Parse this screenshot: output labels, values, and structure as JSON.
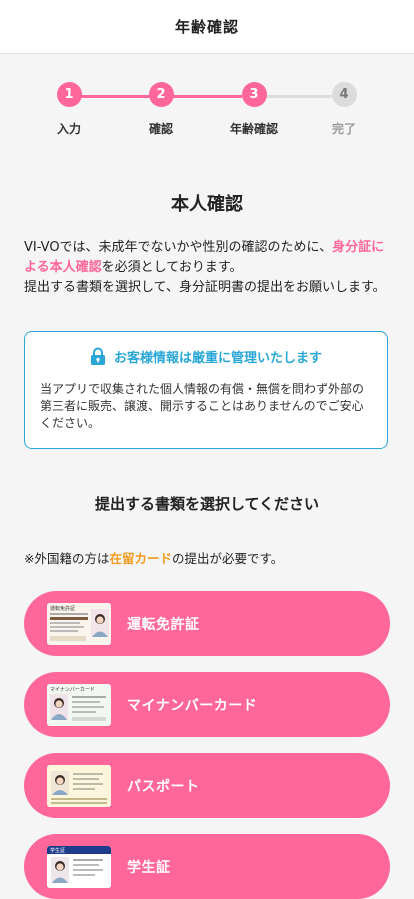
{
  "header": {
    "title": "年齢確認"
  },
  "steps": [
    {
      "number": "1",
      "label": "入力",
      "state": "done"
    },
    {
      "number": "2",
      "label": "確認",
      "state": "done"
    },
    {
      "number": "3",
      "label": "年齢確認",
      "state": "current"
    },
    {
      "number": "4",
      "label": "完了",
      "state": "pending"
    }
  ],
  "identity": {
    "title": "本人確認",
    "intro_part1": "VI-VOでは、未成年でないかや性別の確認のために、",
    "intro_highlight1": "身分証に",
    "intro_highlight2": "よる本人確認",
    "intro_part2": "を必須としております。",
    "intro_line3": "提出する書類を選択して、身分証明書の提出をお願いします。"
  },
  "security": {
    "title": "お客様情報は厳重に管理いたします",
    "body": "当アプリで収集された個人情報の有償・無償を問わず外部の第三者に販売、譲渡、開示することはありませんのでご安心ください。"
  },
  "select": {
    "title": "提出する書類を選択してください",
    "note_prefix": "※外国籍の方は",
    "note_highlight": "在留カード",
    "note_suffix": "の提出が必要です。"
  },
  "documents": [
    {
      "label": "運転免許証",
      "icon": "drivers-license-icon",
      "card_title": "運転免許証"
    },
    {
      "label": "マイナンバーカード",
      "icon": "my-number-card-icon",
      "card_title": "マイナンバーカード"
    },
    {
      "label": "パスポート",
      "icon": "passport-icon",
      "card_title": ""
    },
    {
      "label": "学生証",
      "icon": "student-id-icon",
      "card_title": "学生証"
    }
  ],
  "colors": {
    "accent": "#ff6699",
    "inactive": "#dcdcdc",
    "info": "#2aa7d6",
    "warning": "#f39a1e"
  }
}
